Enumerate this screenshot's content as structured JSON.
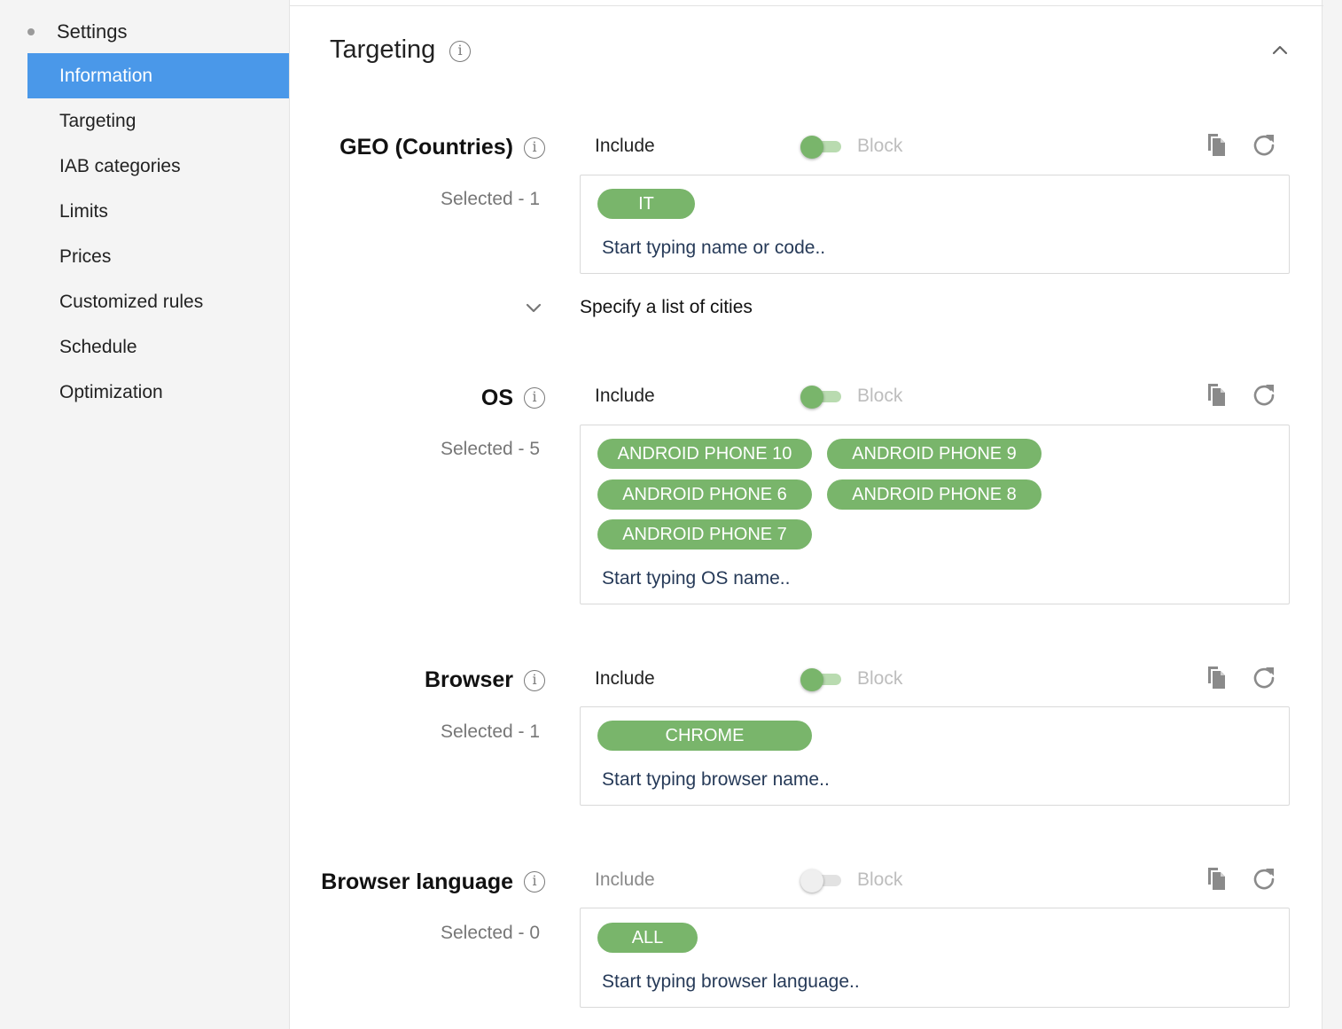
{
  "sidebar": {
    "header": "Settings",
    "items": [
      {
        "label": "Information",
        "active": true
      },
      {
        "label": "Targeting"
      },
      {
        "label": "IAB categories"
      },
      {
        "label": "Limits"
      },
      {
        "label": "Prices"
      },
      {
        "label": "Customized rules"
      },
      {
        "label": "Schedule"
      },
      {
        "label": "Optimization"
      }
    ]
  },
  "panel": {
    "title": "Targeting",
    "info_glyph": "i",
    "collapse_icon": "chevron-up-icon"
  },
  "sections": {
    "geo": {
      "label": "GEO (Countries)",
      "selected": "Selected - 1",
      "include": "Include",
      "block": "Block",
      "toggle_on": true,
      "chips": [
        "IT"
      ],
      "placeholder": "Start typing name or code..",
      "cities_label": "Specify a list of cities"
    },
    "os": {
      "label": "OS",
      "selected": "Selected - 5",
      "include": "Include",
      "block": "Block",
      "toggle_on": true,
      "chips": [
        "ANDROID PHONE 10",
        "ANDROID PHONE 9",
        "ANDROID PHONE 6",
        "ANDROID PHONE 8",
        "ANDROID PHONE 7"
      ],
      "placeholder": "Start typing OS name.."
    },
    "browser": {
      "label": "Browser",
      "selected": "Selected - 1",
      "include": "Include",
      "block": "Block",
      "toggle_on": true,
      "chips": [
        "CHROME"
      ],
      "placeholder": "Start typing browser name.."
    },
    "browser_language": {
      "label": "Browser language",
      "selected": "Selected - 0",
      "include": "Include",
      "block": "Block",
      "toggle_on": false,
      "chips": [
        "ALL"
      ],
      "placeholder": "Start typing browser language.."
    }
  },
  "colors": {
    "accent": "#4a98e9",
    "chip": "#79b56b",
    "toggle_track": "#b9dbb0",
    "input_text": "#263a58"
  },
  "icons": {
    "copy": "copy-icon",
    "reset": "refresh-icon",
    "info": "info-icon",
    "expand": "chevron-down-icon"
  }
}
